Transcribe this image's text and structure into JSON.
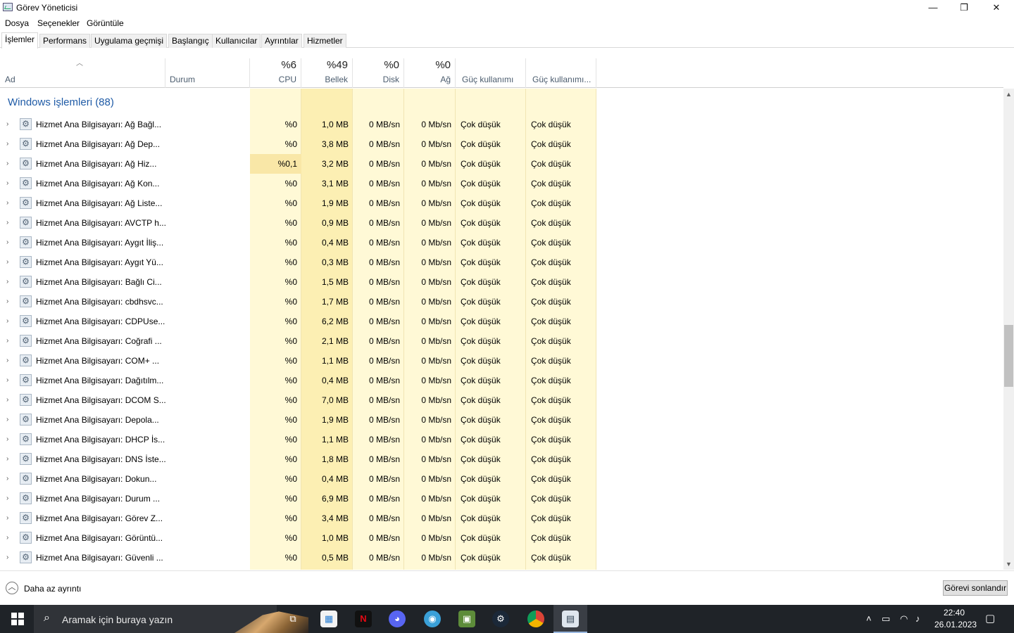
{
  "window": {
    "title": "Görev Yöneticisi",
    "controls": {
      "minimize": "—",
      "restore": "❐",
      "close": "✕"
    }
  },
  "menu": [
    "Dosya",
    "Seçenekler",
    "Görüntüle"
  ],
  "tabs": [
    "İşlemler",
    "Performans",
    "Uygulama geçmişi",
    "Başlangıç",
    "Kullanıcılar",
    "Ayrıntılar",
    "Hizmetler"
  ],
  "active_tab": "İşlemler",
  "columns": {
    "name": {
      "label": "Ad"
    },
    "status": {
      "label": "Durum"
    },
    "cpu": {
      "label": "CPU",
      "percent": "%6"
    },
    "memory": {
      "label": "Bellek",
      "percent": "%49"
    },
    "disk": {
      "label": "Disk",
      "percent": "%0"
    },
    "network": {
      "label": "Ağ",
      "percent": "%0"
    },
    "power": {
      "label": "Güç kullanımı"
    },
    "power_trend": {
      "label": "Güç kullanımı..."
    }
  },
  "group": {
    "title": "Windows işlemleri (88)"
  },
  "rows": [
    {
      "name": "Hizmet Ana Bilgisayarı: Ağ Bağl...",
      "cpu": "%0",
      "mem": "1,0 MB",
      "disk": "0 MB/sn",
      "net": "0 Mb/sn",
      "power": "Çok düşük",
      "trend": "Çok düşük"
    },
    {
      "name": "Hizmet Ana Bilgisayarı: Ağ Dep...",
      "cpu": "%0",
      "mem": "3,8 MB",
      "disk": "0 MB/sn",
      "net": "0 Mb/sn",
      "power": "Çok düşük",
      "trend": "Çok düşük"
    },
    {
      "name": "Hizmet Ana Bilgisayarı: Ağ Hiz...",
      "cpu": "%0,1",
      "mem": "3,2 MB",
      "disk": "0 MB/sn",
      "net": "0 Mb/sn",
      "power": "Çok düşük",
      "trend": "Çok düşük"
    },
    {
      "name": "Hizmet Ana Bilgisayarı: Ağ Kon...",
      "cpu": "%0",
      "mem": "3,1 MB",
      "disk": "0 MB/sn",
      "net": "0 Mb/sn",
      "power": "Çok düşük",
      "trend": "Çok düşük"
    },
    {
      "name": "Hizmet Ana Bilgisayarı: Ağ Liste...",
      "cpu": "%0",
      "mem": "1,9 MB",
      "disk": "0 MB/sn",
      "net": "0 Mb/sn",
      "power": "Çok düşük",
      "trend": "Çok düşük"
    },
    {
      "name": "Hizmet Ana Bilgisayarı: AVCTP h...",
      "cpu": "%0",
      "mem": "0,9 MB",
      "disk": "0 MB/sn",
      "net": "0 Mb/sn",
      "power": "Çok düşük",
      "trend": "Çok düşük"
    },
    {
      "name": "Hizmet Ana Bilgisayarı: Aygıt İliş...",
      "cpu": "%0",
      "mem": "0,4 MB",
      "disk": "0 MB/sn",
      "net": "0 Mb/sn",
      "power": "Çok düşük",
      "trend": "Çok düşük"
    },
    {
      "name": "Hizmet Ana Bilgisayarı: Aygıt Yü...",
      "cpu": "%0",
      "mem": "0,3 MB",
      "disk": "0 MB/sn",
      "net": "0 Mb/sn",
      "power": "Çok düşük",
      "trend": "Çok düşük"
    },
    {
      "name": "Hizmet Ana Bilgisayarı: Bağlı Ci...",
      "cpu": "%0",
      "mem": "1,5 MB",
      "disk": "0 MB/sn",
      "net": "0 Mb/sn",
      "power": "Çok düşük",
      "trend": "Çok düşük"
    },
    {
      "name": "Hizmet Ana Bilgisayarı: cbdhsvc...",
      "cpu": "%0",
      "mem": "1,7 MB",
      "disk": "0 MB/sn",
      "net": "0 Mb/sn",
      "power": "Çok düşük",
      "trend": "Çok düşük"
    },
    {
      "name": "Hizmet Ana Bilgisayarı: CDPUse...",
      "cpu": "%0",
      "mem": "6,2 MB",
      "disk": "0 MB/sn",
      "net": "0 Mb/sn",
      "power": "Çok düşük",
      "trend": "Çok düşük"
    },
    {
      "name": "Hizmet Ana Bilgisayarı: Coğrafi ...",
      "cpu": "%0",
      "mem": "2,1 MB",
      "disk": "0 MB/sn",
      "net": "0 Mb/sn",
      "power": "Çok düşük",
      "trend": "Çok düşük"
    },
    {
      "name": "Hizmet Ana Bilgisayarı: COM+ ...",
      "cpu": "%0",
      "mem": "1,1 MB",
      "disk": "0 MB/sn",
      "net": "0 Mb/sn",
      "power": "Çok düşük",
      "trend": "Çok düşük"
    },
    {
      "name": "Hizmet Ana Bilgisayarı: Dağıtılm...",
      "cpu": "%0",
      "mem": "0,4 MB",
      "disk": "0 MB/sn",
      "net": "0 Mb/sn",
      "power": "Çok düşük",
      "trend": "Çok düşük"
    },
    {
      "name": "Hizmet Ana Bilgisayarı: DCOM S...",
      "cpu": "%0",
      "mem": "7,0 MB",
      "disk": "0 MB/sn",
      "net": "0 Mb/sn",
      "power": "Çok düşük",
      "trend": "Çok düşük"
    },
    {
      "name": "Hizmet Ana Bilgisayarı: Depola...",
      "cpu": "%0",
      "mem": "1,9 MB",
      "disk": "0 MB/sn",
      "net": "0 Mb/sn",
      "power": "Çok düşük",
      "trend": "Çok düşük"
    },
    {
      "name": "Hizmet Ana Bilgisayarı: DHCP İs...",
      "cpu": "%0",
      "mem": "1,1 MB",
      "disk": "0 MB/sn",
      "net": "0 Mb/sn",
      "power": "Çok düşük",
      "trend": "Çok düşük"
    },
    {
      "name": "Hizmet Ana Bilgisayarı: DNS İste...",
      "cpu": "%0",
      "mem": "1,8 MB",
      "disk": "0 MB/sn",
      "net": "0 Mb/sn",
      "power": "Çok düşük",
      "trend": "Çok düşük"
    },
    {
      "name": "Hizmet Ana Bilgisayarı: Dokun...",
      "cpu": "%0",
      "mem": "0,4 MB",
      "disk": "0 MB/sn",
      "net": "0 Mb/sn",
      "power": "Çok düşük",
      "trend": "Çok düşük"
    },
    {
      "name": "Hizmet Ana Bilgisayarı: Durum ...",
      "cpu": "%0",
      "mem": "6,9 MB",
      "disk": "0 MB/sn",
      "net": "0 Mb/sn",
      "power": "Çok düşük",
      "trend": "Çok düşük"
    },
    {
      "name": "Hizmet Ana Bilgisayarı: Görev Z...",
      "cpu": "%0",
      "mem": "3,4 MB",
      "disk": "0 MB/sn",
      "net": "0 Mb/sn",
      "power": "Çok düşük",
      "trend": "Çok düşük"
    },
    {
      "name": "Hizmet Ana Bilgisayarı: Görüntü...",
      "cpu": "%0",
      "mem": "1,0 MB",
      "disk": "0 MB/sn",
      "net": "0 Mb/sn",
      "power": "Çok düşük",
      "trend": "Çok düşük"
    },
    {
      "name": "Hizmet Ana Bilgisayarı: Güvenli ...",
      "cpu": "%0",
      "mem": "0,5 MB",
      "disk": "0 MB/sn",
      "net": "0 Mb/sn",
      "power": "Çok düşük",
      "trend": "Çok düşük"
    }
  ],
  "footer": {
    "fewer_details": "Daha az ayrıntı",
    "end_task": "Görevi sonlandır"
  },
  "taskbar": {
    "search_placeholder": "Aramak için buraya yazın",
    "apps": [
      "task-view",
      "microsoft-store",
      "netflix",
      "discord",
      "edge-like-browser",
      "minecraft",
      "steam",
      "chrome",
      "task-manager"
    ],
    "time": "22:40",
    "date": "26.01.2023"
  },
  "colors": {
    "group_title": "#1f5ba6",
    "cell_light": "#fff9d6",
    "cell_mid": "#fcefb3",
    "cell_highlight": "#f9e7a7",
    "taskbar": "#1f2328"
  }
}
